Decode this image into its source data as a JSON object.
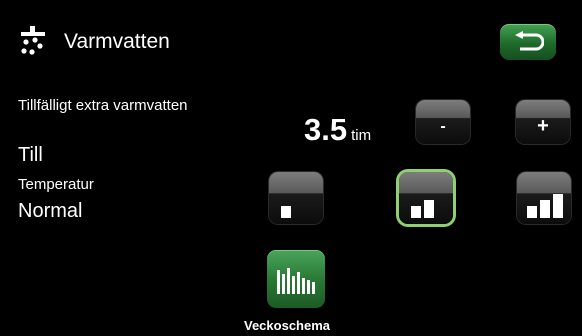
{
  "header": {
    "title": "Varmvatten",
    "icon": "shower-icon",
    "back_icon": "back-arrow-icon"
  },
  "extra_hot_water": {
    "label": "Tillfälligt extra varmvatten",
    "value": "Till"
  },
  "timer": {
    "value": "3.5",
    "unit": "tim"
  },
  "stepper": {
    "minus_label": "-",
    "plus_label": "+"
  },
  "temperature": {
    "label": "Temperatur",
    "value": "Normal",
    "levels": [
      {
        "name": "level-1",
        "bars": 1,
        "selected": false
      },
      {
        "name": "level-2",
        "bars": 2,
        "selected": true
      },
      {
        "name": "level-3",
        "bars": 3,
        "selected": false
      }
    ]
  },
  "schedule": {
    "label": "Veckoschema",
    "icon": "bar-chart-icon"
  },
  "colors": {
    "green": "#2e8b3f",
    "selected_outline": "#8fd070",
    "background": "#000000"
  }
}
